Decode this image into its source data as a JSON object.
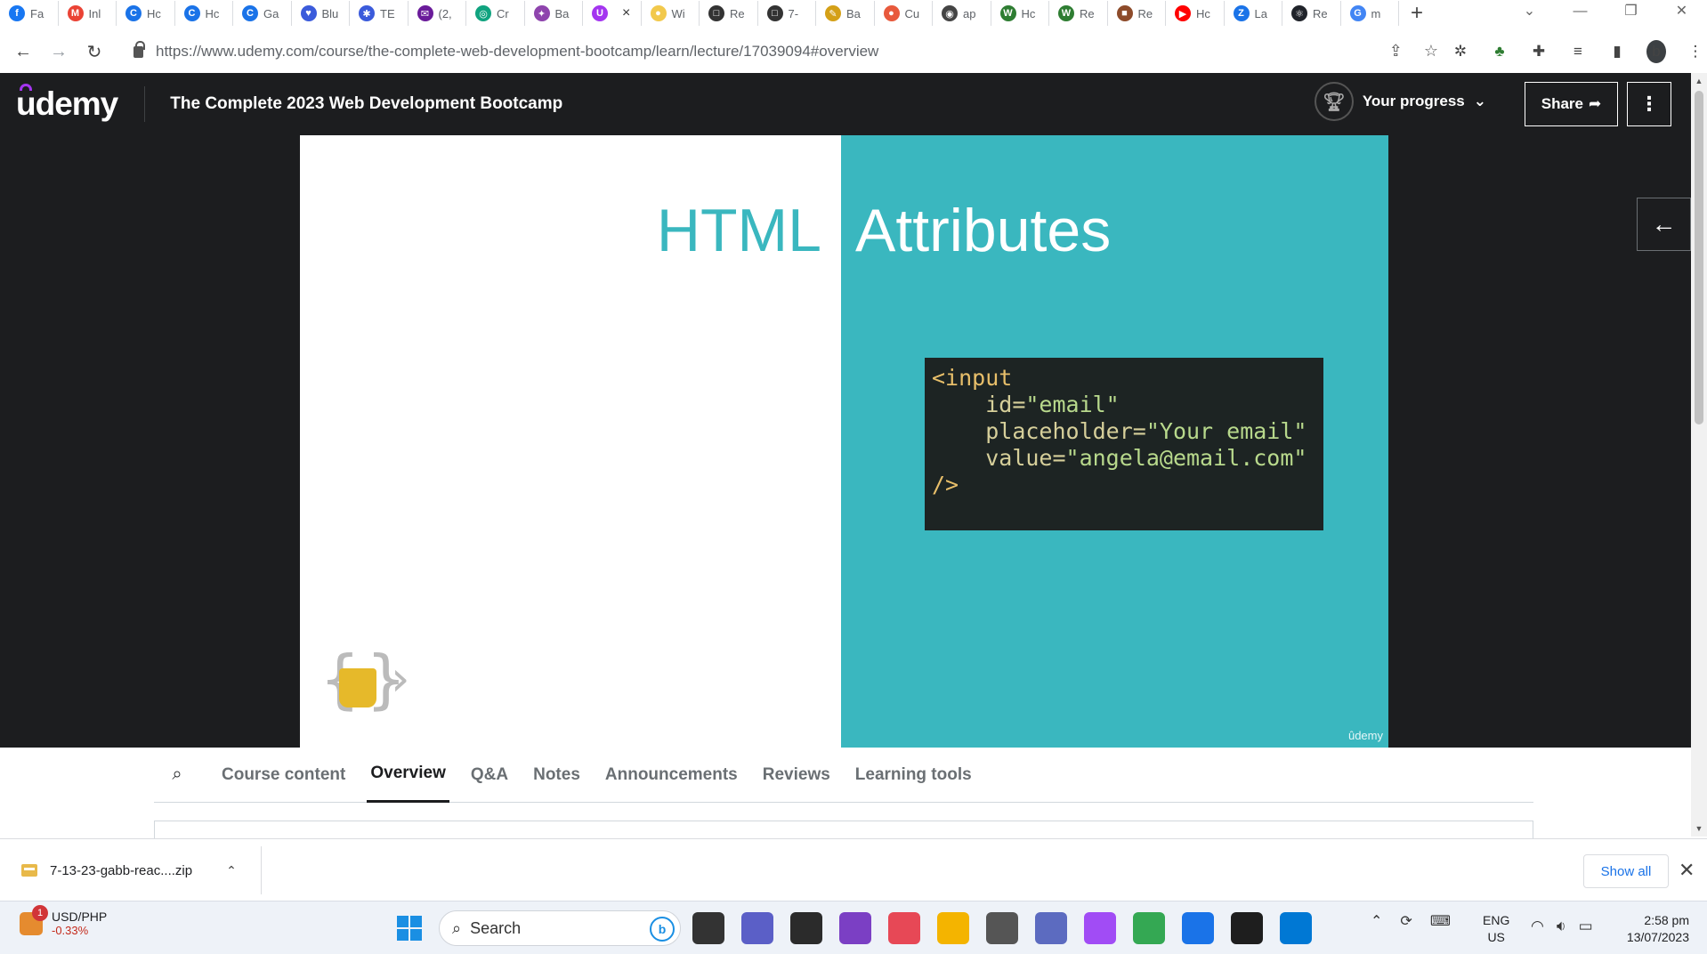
{
  "browser": {
    "tabs": [
      {
        "label": "Fa",
        "color": "#1877f2",
        "glyph": "f"
      },
      {
        "label": "Inl",
        "color": "#ea4335",
        "glyph": "M"
      },
      {
        "label": "Hc",
        "color": "#1a73e8",
        "glyph": "C"
      },
      {
        "label": "Hc",
        "color": "#1a73e8",
        "glyph": "C"
      },
      {
        "label": "Ga",
        "color": "#1a73e8",
        "glyph": "C"
      },
      {
        "label": "Blu",
        "color": "#3b5bdb",
        "glyph": "♥"
      },
      {
        "label": "TE",
        "color": "#3b5bdb",
        "glyph": "✱"
      },
      {
        "label": "(2,",
        "color": "#6a1b9a",
        "glyph": "✉"
      },
      {
        "label": "Cr",
        "color": "#10a37f",
        "glyph": "◎"
      },
      {
        "label": "Ba",
        "color": "#8e44ad",
        "glyph": "✦"
      },
      {
        "label": "",
        "color": "#a435f0",
        "glyph": "U",
        "active": true
      },
      {
        "label": "Wi",
        "color": "#f2c94c",
        "glyph": "●"
      },
      {
        "label": "Re",
        "color": "#333333",
        "glyph": "□"
      },
      {
        "label": "7-",
        "color": "#333333",
        "glyph": "□"
      },
      {
        "label": "Ba",
        "color": "#d4a017",
        "glyph": "✎"
      },
      {
        "label": "Cu",
        "color": "#e8593c",
        "glyph": "●"
      },
      {
        "label": "ap",
        "color": "#444444",
        "glyph": "◉"
      },
      {
        "label": "Hc",
        "color": "#2e7d32",
        "glyph": "W"
      },
      {
        "label": "Re",
        "color": "#2e7d32",
        "glyph": "W"
      },
      {
        "label": "Re",
        "color": "#8d4b2a",
        "glyph": "■"
      },
      {
        "label": "Hc",
        "color": "#ff0000",
        "glyph": "▶"
      },
      {
        "label": "La",
        "color": "#1a73e8",
        "glyph": "Z"
      },
      {
        "label": "Re",
        "color": "#20232a",
        "glyph": "⚛"
      },
      {
        "label": "m",
        "color": "#4285f4",
        "glyph": "G"
      }
    ],
    "new_tab": "+",
    "url_host": "https://www.udemy.com",
    "url_path": "/course/the-complete-web-development-bootcamp/learn/lecture/17039094#overview",
    "profile_initial": "b"
  },
  "header": {
    "logo": "udemy",
    "course_title": "The Complete 2023 Web Development Bootcamp",
    "progress_label": "Your progress",
    "share_label": "Share"
  },
  "slide": {
    "title_left": "HTML",
    "title_right": "Attributes",
    "code_lines": [
      {
        "indent": "",
        "parts": [
          {
            "t": "<input",
            "c": "tag"
          }
        ]
      },
      {
        "indent": "    ",
        "parts": [
          {
            "t": "id=",
            "c": "attr"
          },
          {
            "t": "\"email\"",
            "c": "str"
          }
        ]
      },
      {
        "indent": "    ",
        "parts": [
          {
            "t": "placeholder=",
            "c": "attr"
          },
          {
            "t": "\"Your email\"",
            "c": "str"
          }
        ]
      },
      {
        "indent": "    ",
        "parts": [
          {
            "t": "value=",
            "c": "attr"
          },
          {
            "t": "\"angela@email.com\"",
            "c": "str"
          }
        ]
      },
      {
        "indent": "",
        "parts": [
          {
            "t": "/>",
            "c": "tag"
          }
        ]
      }
    ],
    "watermark": "ûdemy"
  },
  "course_tabs": [
    "Course content",
    "Overview",
    "Q&A",
    "Notes",
    "Announcements",
    "Reviews",
    "Learning tools"
  ],
  "active_tab": "Overview",
  "download": {
    "filename": "7-13-23-gabb-reac....zip",
    "show_all": "Show all"
  },
  "taskbar": {
    "stock_name": "USD/PHP",
    "stock_change": "-0.33%",
    "notification_count": "1",
    "search_label": "Search",
    "app_colors": [
      "#333333",
      "#5b5fc7",
      "#2b2b2b",
      "#7b3fc4",
      "#e74856",
      "#f4b400",
      "#555555",
      "#5c6bc0",
      "#a14cf5",
      "#34a853",
      "#1a73e8",
      "#1e1e1e",
      "#0078d4"
    ],
    "lang_top": "ENG",
    "lang_bottom": "US",
    "time": "2:58 pm",
    "date": "13/07/2023"
  }
}
